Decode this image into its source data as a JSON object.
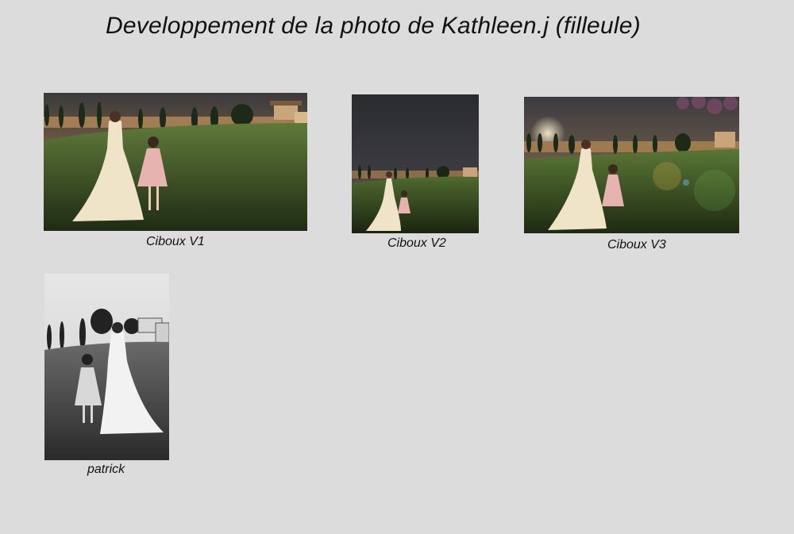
{
  "page": {
    "title": "Developpement de la photo de Kathleen.j (filleule)"
  },
  "photos": [
    {
      "caption": "Ciboux V1",
      "style": "color-warm"
    },
    {
      "caption": "Ciboux V2",
      "style": "color-dark-sky"
    },
    {
      "caption": "Ciboux V3",
      "style": "color-lens-flare"
    },
    {
      "caption": "patrick",
      "style": "black-and-white"
    }
  ],
  "colors": {
    "background": "#dcdcdc",
    "text": "#111111"
  }
}
